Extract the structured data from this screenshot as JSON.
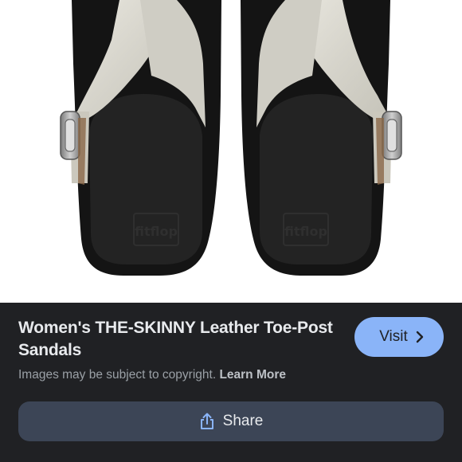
{
  "image": {
    "subject": "sandals-photo",
    "colors": {
      "sole": "#1b1b1b",
      "strap": "#dcdad2",
      "buckle": "#a5a5a5"
    }
  },
  "result": {
    "title": "Women's THE-SKINNY Leather Toe-Post Sandals",
    "visit_label": "Visit",
    "copyright_text": "Images may be subject to copyright.",
    "learn_more_label": "Learn More",
    "share_label": "Share"
  },
  "colors": {
    "panel_background": "#202124",
    "visit_button": "#8ab4f8",
    "share_button": "#3c4556",
    "text_primary": "#e8eaed",
    "text_secondary": "#9aa0a6"
  }
}
